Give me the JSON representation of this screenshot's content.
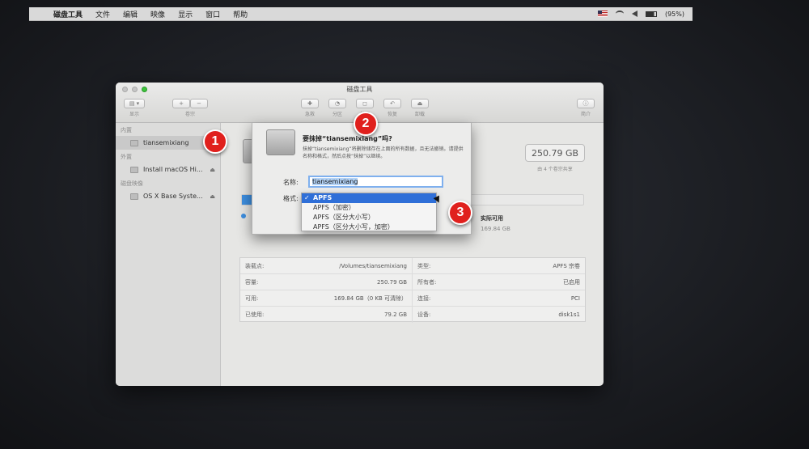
{
  "menubar": {
    "items": [
      "磁盘工具",
      "文件",
      "编辑",
      "映像",
      "显示",
      "窗口",
      "帮助"
    ],
    "battery": "(95%)"
  },
  "window": {
    "title": "磁盘工具",
    "toolbar": {
      "view": "显示",
      "volume": "卷宗",
      "firstaid": "急救",
      "partition": "分区",
      "erase": "抹掉",
      "restore": "恢复",
      "unmount": "卸载",
      "info": "简介"
    }
  },
  "sidebar": {
    "sections": [
      {
        "header": "内置",
        "items": [
          {
            "label": "tiansemixiang",
            "selected": true,
            "eject": ""
          }
        ]
      },
      {
        "header": "外置",
        "items": [
          {
            "label": "Install macOS Hi...",
            "selected": false,
            "eject": "⏏"
          }
        ]
      },
      {
        "header": "磁盘映像",
        "items": [
          {
            "label": "OS X Base Syste...",
            "selected": false,
            "eject": "⏏"
          }
        ]
      }
    ]
  },
  "volume": {
    "size": "250.79 GB",
    "shared": "由 4 个卷宗共享",
    "available_label": "实际可用",
    "available_value": "169.84 GB",
    "used_fraction": 0.32,
    "erase_peek": "抹掉"
  },
  "info_table": [
    [
      {
        "k": "装载点:",
        "v": "/Volumes/tiansemixiang"
      },
      {
        "k": "类型:",
        "v": "APFS 宗卷"
      }
    ],
    [
      {
        "k": "容量:",
        "v": "250.79 GB"
      },
      {
        "k": "所有者:",
        "v": "已启用"
      }
    ],
    [
      {
        "k": "可用:",
        "v": "169.84 GB（0 KB 可清除）"
      },
      {
        "k": "连接:",
        "v": "PCI"
      }
    ],
    [
      {
        "k": "已使用:",
        "v": "79.2 GB"
      },
      {
        "k": "设备:",
        "v": "disk1s1"
      }
    ]
  ],
  "dialog": {
    "title": "要抹掉“tiansemixiang”吗?",
    "message": "抹掉“tiansemixiang”将删除储存在上面的所有数据，且无法撤销。请提供名称和格式，然后点按“抹掉”以继续。",
    "name_label": "名称:",
    "name_value": "tiansemixiang",
    "format_label": "格式:",
    "format_options": [
      "APFS",
      "APFS（加密）",
      "APFS（区分大小写）",
      "APFS（区分大小写，加密）"
    ],
    "selected_format": "APFS"
  },
  "markers": [
    "1",
    "2",
    "3"
  ],
  "colors": {
    "accent": "#2f6fd8",
    "marker": "#e0201d",
    "usage": "#3d8ee0"
  }
}
